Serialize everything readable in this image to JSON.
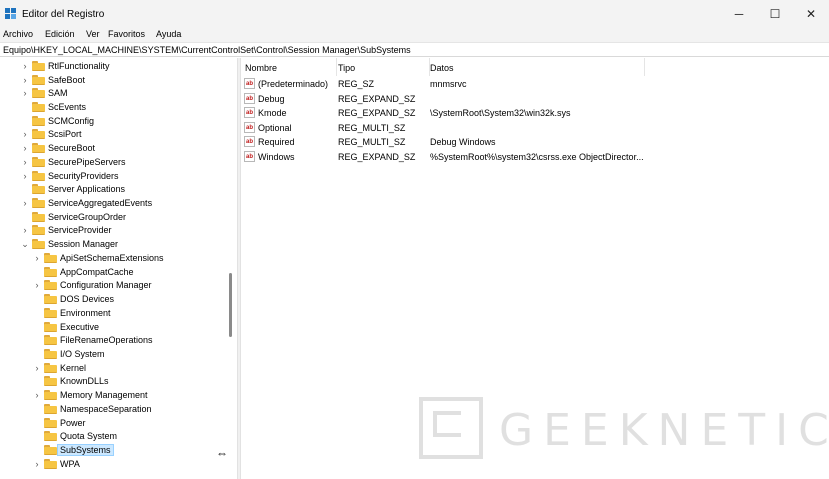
{
  "window": {
    "title": "Editor del Registro",
    "minimize_glyph": "─",
    "maximize_glyph": "☐",
    "close_glyph": "✕"
  },
  "menu": [
    "Archivo",
    "Edición",
    "Ver",
    "Favoritos",
    "Ayuda"
  ],
  "address": "Equipo\\HKEY_LOCAL_MACHINE\\SYSTEM\\CurrentControlSet\\Control\\Session Manager\\SubSystems",
  "tree": [
    {
      "label": "RtlFunctionality",
      "level": 0,
      "expander": "collapsed"
    },
    {
      "label": "SafeBoot",
      "level": 0,
      "expander": "collapsed"
    },
    {
      "label": "SAM",
      "level": 0,
      "expander": "collapsed"
    },
    {
      "label": "ScEvents",
      "level": 0,
      "expander": "none"
    },
    {
      "label": "SCMConfig",
      "level": 0,
      "expander": "none"
    },
    {
      "label": "ScsiPort",
      "level": 0,
      "expander": "collapsed"
    },
    {
      "label": "SecureBoot",
      "level": 0,
      "expander": "collapsed"
    },
    {
      "label": "SecurePipeServers",
      "level": 0,
      "expander": "collapsed"
    },
    {
      "label": "SecurityProviders",
      "level": 0,
      "expander": "collapsed"
    },
    {
      "label": "Server Applications",
      "level": 0,
      "expander": "none"
    },
    {
      "label": "ServiceAggregatedEvents",
      "level": 0,
      "expander": "collapsed"
    },
    {
      "label": "ServiceGroupOrder",
      "level": 0,
      "expander": "none"
    },
    {
      "label": "ServiceProvider",
      "level": 0,
      "expander": "collapsed"
    },
    {
      "label": "Session Manager",
      "level": 0,
      "expander": "expanded"
    },
    {
      "label": "ApiSetSchemaExtensions",
      "level": 1,
      "expander": "collapsed"
    },
    {
      "label": "AppCompatCache",
      "level": 1,
      "expander": "none"
    },
    {
      "label": "Configuration Manager",
      "level": 1,
      "expander": "collapsed"
    },
    {
      "label": "DOS Devices",
      "level": 1,
      "expander": "none"
    },
    {
      "label": "Environment",
      "level": 1,
      "expander": "none"
    },
    {
      "label": "Executive",
      "level": 1,
      "expander": "none"
    },
    {
      "label": "FileRenameOperations",
      "level": 1,
      "expander": "none"
    },
    {
      "label": "I/O System",
      "level": 1,
      "expander": "none"
    },
    {
      "label": "Kernel",
      "level": 1,
      "expander": "collapsed"
    },
    {
      "label": "KnownDLLs",
      "level": 1,
      "expander": "none"
    },
    {
      "label": "Memory Management",
      "level": 1,
      "expander": "collapsed"
    },
    {
      "label": "NamespaceSeparation",
      "level": 1,
      "expander": "none"
    },
    {
      "label": "Power",
      "level": 1,
      "expander": "none"
    },
    {
      "label": "Quota System",
      "level": 1,
      "expander": "none"
    },
    {
      "label": "SubSystems",
      "level": 1,
      "expander": "none",
      "selected": true
    },
    {
      "label": "WPA",
      "level": 1,
      "expander": "collapsed"
    }
  ],
  "columns": [
    "Nombre",
    "Tipo",
    "Datos"
  ],
  "values": [
    {
      "name": "(Predeterminado)",
      "type": "REG_SZ",
      "data": "mnmsrvc"
    },
    {
      "name": "Debug",
      "type": "REG_EXPAND_SZ",
      "data": ""
    },
    {
      "name": "Kmode",
      "type": "REG_EXPAND_SZ",
      "data": "\\SystemRoot\\System32\\win32k.sys"
    },
    {
      "name": "Optional",
      "type": "REG_MULTI_SZ",
      "data": ""
    },
    {
      "name": "Required",
      "type": "REG_MULTI_SZ",
      "data": "Debug Windows"
    },
    {
      "name": "Windows",
      "type": "REG_EXPAND_SZ",
      "data": "%SystemRoot%\\system32\\csrss.exe ObjectDirector..."
    }
  ],
  "value_icon_text": "ab",
  "watermark": "GEEKNETIC",
  "icons": {
    "app": "regedit-icon",
    "expander_collapsed": "›",
    "expander_expanded": "⌄",
    "resize_cursor": "⇔"
  },
  "colors": {
    "folder": "#f6c543",
    "selection": "#cce8ff",
    "chrome": "#f3f3f3"
  }
}
